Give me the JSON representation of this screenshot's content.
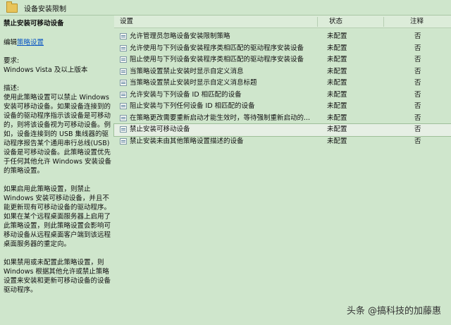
{
  "window": {
    "title": "设备安装限制"
  },
  "left_panel": {
    "heading": "禁止安装可移动设备",
    "edit_prefix": "编辑",
    "edit_link": "策略设置",
    "requirement_label": "要求:",
    "requirement_value": "Windows Vista 及以上版本",
    "description_label": "描述:",
    "description_1": "使用此策略设置可以禁止 Windows 安装可移动设备。如果设备连接到的设备的驱动程序指示该设备是可移动的，则将该设备视为可移动设备。例如，设备连接到的 USB 集线器的驱动程序报告某个通用串行总线(USB)设备是可移动设备。此策略设置优先于任何其他允许 Windows 安装设备的策略设置。",
    "description_2": "如果启用此策略设置，则禁止 Windows 安装可移动设备，并且不能更新现有可移动设备的驱动程序。如果在某个远程桌面服务器上启用了此策略设置，则此策略设置会影响可移动设备从远程桌面客户端到该远程桌面服务器的重定向。",
    "description_3": "如果禁用或未配置此策略设置，则 Windows 根据其他允许或禁止策略设置来安装和更新可移动设备的设备驱动程序。"
  },
  "table": {
    "headers": {
      "setting": "设置",
      "state": "状态",
      "comment": "注释"
    },
    "rows": [
      {
        "name": "允许管理员忽略设备安装限制策略",
        "state": "未配置",
        "comment": "否"
      },
      {
        "name": "允许使用与下列设备安装程序类相匹配的驱动程序安装设备",
        "state": "未配置",
        "comment": "否"
      },
      {
        "name": "阻止使用与下列设备安装程序类相匹配的驱动程序安装设备",
        "state": "未配置",
        "comment": "否"
      },
      {
        "name": "当策略设置禁止安装时显示自定义消息",
        "state": "未配置",
        "comment": "否"
      },
      {
        "name": "当策略设置禁止安装时显示自定义消息标题",
        "state": "未配置",
        "comment": "否"
      },
      {
        "name": "允许安装与下列设备 ID 相匹配的设备",
        "state": "未配置",
        "comment": "否"
      },
      {
        "name": "阻止安装与下列任何设备 ID 相匹配的设备",
        "state": "未配置",
        "comment": "否"
      },
      {
        "name": "在策略更改需要重新启动才能生效时，等待强制重新启动的...",
        "state": "未配置",
        "comment": "否"
      },
      {
        "name": "禁止安装可移动设备",
        "state": "未配置",
        "comment": "否"
      },
      {
        "name": "禁止安装未由其他策略设置描述的设备",
        "state": "未配置",
        "comment": "否"
      }
    ]
  },
  "watermark": "头条 @搞科技的加藤惠"
}
